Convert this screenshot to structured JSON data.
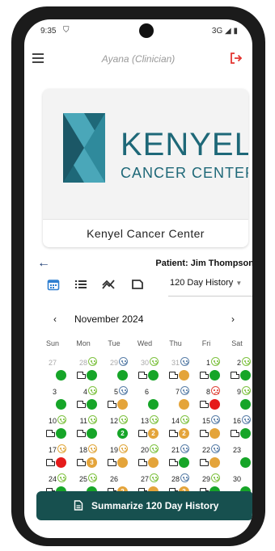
{
  "status_bar": {
    "time": "9:35",
    "network": "3G ◢ ▮"
  },
  "app_bar": {
    "title": "Ayana (Clinician)"
  },
  "clinic": {
    "logo_title": "KENYEL",
    "logo_subtitle": "CANCER CENTER",
    "name": "Kenyel Cancer Center"
  },
  "patient": {
    "label": "Patient: Jim Thompson"
  },
  "history_select": {
    "value": "120 Day History"
  },
  "calendar": {
    "month_label": "November 2024",
    "prev_glyph": "‹",
    "next_glyph": "›",
    "weekdays": [
      "Sun",
      "Mon",
      "Tue",
      "Wed",
      "Thu",
      "Fri",
      "Sat"
    ],
    "weeks": [
      [
        {
          "day": "27",
          "other": true,
          "dot": "green"
        },
        {
          "day": "28",
          "other": true,
          "mood": "green",
          "note": true,
          "dot": "green"
        },
        {
          "day": "29",
          "other": true,
          "mood": "blue",
          "dot": "green"
        },
        {
          "day": "30",
          "other": true,
          "mood": "green",
          "note": true,
          "dot": "green"
        },
        {
          "day": "31",
          "other": true,
          "mood": "blue",
          "note": true,
          "dot": "yellow"
        },
        {
          "day": "1",
          "mood": "green",
          "note": true,
          "dot": "green"
        },
        {
          "day": "2",
          "mood": "green",
          "note": true,
          "dot": "green"
        }
      ],
      [
        {
          "day": "3",
          "dot": "green"
        },
        {
          "day": "4",
          "mood": "green",
          "note": true,
          "dot": "green"
        },
        {
          "day": "5",
          "mood": "blue",
          "note": true,
          "dot": "yellow"
        },
        {
          "day": "6",
          "dot": "green"
        },
        {
          "day": "7",
          "mood": "blue",
          "dot": "yellow"
        },
        {
          "day": "8",
          "mood": "red",
          "note": true,
          "dot": "red"
        },
        {
          "day": "9",
          "mood": "green",
          "dot": "green"
        }
      ],
      [
        {
          "day": "10",
          "mood": "green",
          "note": true,
          "dot": "green"
        },
        {
          "day": "11",
          "mood": "green",
          "note": true,
          "dot": "green"
        },
        {
          "day": "12",
          "mood": "green",
          "dot": "green",
          "count": "2"
        },
        {
          "day": "13",
          "mood": "green",
          "note": true,
          "dot": "yellow",
          "count": "2"
        },
        {
          "day": "14",
          "mood": "green",
          "note": true,
          "dot": "yellow",
          "count": "2"
        },
        {
          "day": "15",
          "mood": "blue",
          "note": true,
          "dot": "yellow"
        },
        {
          "day": "16",
          "mood": "blue",
          "note": true,
          "dot": "green"
        }
      ],
      [
        {
          "day": "17",
          "mood": "yellow",
          "note": true,
          "dot": "red"
        },
        {
          "day": "18",
          "mood": "yellow",
          "note": true,
          "dot": "yellow",
          "count": "3"
        },
        {
          "day": "19",
          "mood": "yellow",
          "note": true,
          "dot": "yellow"
        },
        {
          "day": "20",
          "mood": "green",
          "note": true,
          "dot": "yellow"
        },
        {
          "day": "21",
          "mood": "blue",
          "note": true,
          "dot": "green"
        },
        {
          "day": "22",
          "mood": "blue",
          "note": true,
          "dot": "yellow"
        },
        {
          "day": "23",
          "dot": "green"
        }
      ],
      [
        {
          "day": "24",
          "mood": "green",
          "note": true,
          "dot": "green"
        },
        {
          "day": "25",
          "mood": "green",
          "dot": "green"
        },
        {
          "day": "26",
          "note": true,
          "dot": "yellow",
          "count": "2"
        },
        {
          "day": "27",
          "mood": "green",
          "note": true,
          "dot": "yellow"
        },
        {
          "day": "28",
          "mood": "blue",
          "note": true,
          "dot": "yellow",
          "count": "2"
        },
        {
          "day": "29",
          "mood": "green",
          "note": true,
          "dot": "green"
        },
        {
          "day": "30",
          "dot": "green"
        }
      ]
    ]
  },
  "summarize_button": {
    "label": "Summarize 120 Day History"
  },
  "colors": {
    "brand_teal": "#17504f",
    "logo_teal": "#1e6878",
    "dot_green": "#16a528",
    "dot_yellow": "#e4a43a",
    "dot_red": "#e51b1b"
  }
}
